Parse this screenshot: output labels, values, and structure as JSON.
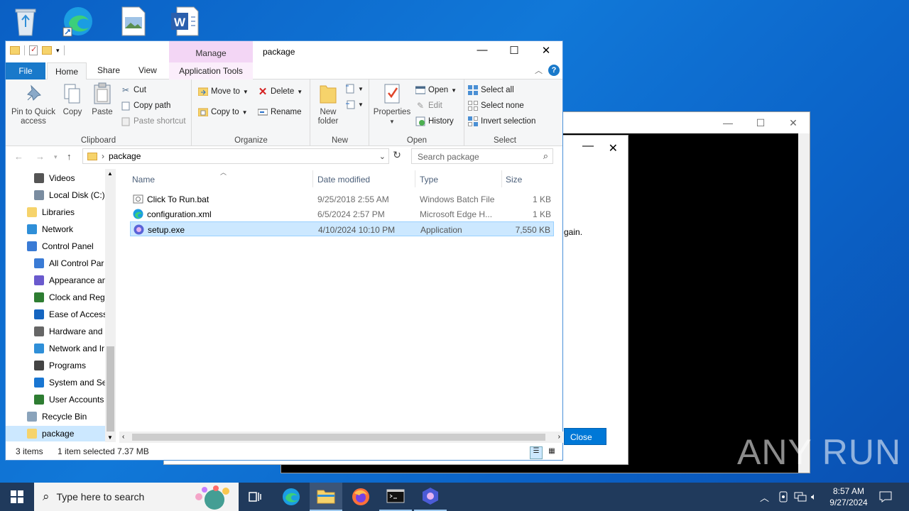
{
  "desktop": {
    "icons": [
      "recycle-bin",
      "edge",
      "image-file",
      "word"
    ]
  },
  "console": {
    "min": "—",
    "max": "☐",
    "close": "✕"
  },
  "dialog": {
    "text": "gain.",
    "close_button": "Close",
    "min": "—",
    "close_x": "✕"
  },
  "explorer": {
    "title": "package",
    "manage_tab": "Manage",
    "tabs": {
      "file": "File",
      "home": "Home",
      "share": "Share",
      "view": "View",
      "app_tools": "Application Tools"
    },
    "ribbon": {
      "clipboard": {
        "label": "Clipboard",
        "pin": "Pin to Quick access",
        "copy": "Copy",
        "paste": "Paste",
        "cut": "Cut",
        "copy_path": "Copy path",
        "paste_shortcut": "Paste shortcut"
      },
      "organize": {
        "label": "Organize",
        "move_to": "Move to",
        "copy_to": "Copy to",
        "delete": "Delete",
        "rename": "Rename"
      },
      "new": {
        "label": "New",
        "new_folder": "New folder"
      },
      "open": {
        "label": "Open",
        "properties": "Properties",
        "open": "Open",
        "edit": "Edit",
        "history": "History"
      },
      "select": {
        "label": "Select",
        "select_all": "Select all",
        "select_none": "Select none",
        "invert": "Invert selection"
      }
    },
    "address": {
      "path": "package",
      "search_placeholder": "Search package"
    },
    "nav": [
      {
        "label": "Videos",
        "icon": "videos-icon"
      },
      {
        "label": "Local Disk (C:)",
        "icon": "drive-icon"
      },
      {
        "label": "Libraries",
        "icon": "libraries-icon"
      },
      {
        "label": "Network",
        "icon": "network-icon"
      },
      {
        "label": "Control Panel",
        "icon": "control-panel-icon"
      },
      {
        "label": "All Control Par",
        "icon": "control-panel-icon"
      },
      {
        "label": "Appearance an",
        "icon": "appearance-icon"
      },
      {
        "label": "Clock and Regi",
        "icon": "clock-icon"
      },
      {
        "label": "Ease of Access",
        "icon": "ease-icon"
      },
      {
        "label": "Hardware and",
        "icon": "hardware-icon"
      },
      {
        "label": "Network and Ir",
        "icon": "network-icon"
      },
      {
        "label": "Programs",
        "icon": "programs-icon"
      },
      {
        "label": "System and Sec",
        "icon": "shield-icon"
      },
      {
        "label": "User Accounts",
        "icon": "users-icon"
      },
      {
        "label": "Recycle Bin",
        "icon": "recycle-bin-icon"
      },
      {
        "label": "package",
        "icon": "folder-icon"
      }
    ],
    "columns": {
      "name": "Name",
      "date": "Date modified",
      "type": "Type",
      "size": "Size"
    },
    "files": [
      {
        "name": "Click To Run.bat",
        "date": "9/25/2018 2:55 AM",
        "type": "Windows Batch File",
        "size": "1 KB",
        "icon": "batch-file-icon"
      },
      {
        "name": "configuration.xml",
        "date": "6/5/2024 2:57 PM",
        "type": "Microsoft Edge H...",
        "size": "1 KB",
        "icon": "edge-icon"
      },
      {
        "name": "setup.exe",
        "date": "4/10/2024 10:10 PM",
        "type": "Application",
        "size": "7,550 KB",
        "icon": "setup-icon"
      }
    ],
    "status": {
      "items": "3 items",
      "selected": "1 item selected  7.37 MB"
    }
  },
  "taskbar": {
    "search_placeholder": "Type here to search",
    "time": "8:57 AM",
    "date": "9/27/2024"
  },
  "watermark": "ANY RUN",
  "colors": {
    "accent": "#0078d7",
    "file_tab": "#1979ca",
    "manage": "#f3d6f5",
    "selection": "#cce8ff"
  }
}
